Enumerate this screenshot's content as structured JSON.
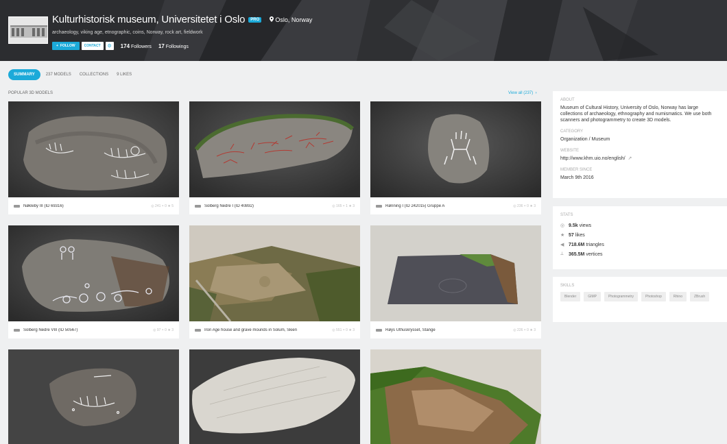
{
  "profile": {
    "name": "Kulturhistorisk museum, Universitetet i Oslo",
    "pro_badge": "PRO",
    "location": "Oslo, Norway",
    "tags": "archaeology, viking age, etnographic, coins, Norway, rock art, fieldwork",
    "follow_label": "FOLLOW",
    "contact_label": "CONTACT",
    "followers_count": "174",
    "followers_label": "Followers",
    "followings_count": "17",
    "followings_label": "Followings"
  },
  "tabs": [
    {
      "label": "SUMMARY",
      "active": true
    },
    {
      "label": "237 MODELS",
      "active": false
    },
    {
      "label": "COLLECTIONS",
      "active": false
    },
    {
      "label": "9 LIKES",
      "active": false
    }
  ],
  "popular": {
    "label": "POPULAR 3D MODELS",
    "view_all": "View all (237)",
    "models": [
      {
        "name": "Nøkleby III (ID 69316)",
        "meta": "◎ 241  ◓ 0  ★ 5"
      },
      {
        "name": "Solberg Nedre I (ID 40892)",
        "meta": "◎ 165  ◓ 1  ★ 3"
      },
      {
        "name": "Rønning I (ID 242015) Gruppe A",
        "meta": "◎ 236  ◓ 0  ★ 3"
      },
      {
        "name": "Solberg Nedre VIII (ID 50567)",
        "meta": "◎ 97  ◓ 0  ★ 3"
      },
      {
        "name": "Iron Age house and grave mounds in Solum, Skien",
        "meta": "◎ 551  ◓ 0  ★ 3"
      },
      {
        "name": "Røys Uthuskrysset, Stange",
        "meta": "◎ 226  ◓ 0  ★ 3"
      },
      {
        "name": "",
        "meta": ""
      },
      {
        "name": "",
        "meta": ""
      },
      {
        "name": "",
        "meta": ""
      }
    ]
  },
  "about": {
    "label": "ABOUT",
    "text": "Museum of Cultural History, University of Oslo, Norway has large collections of archaeology, ethnography and numismatics. We use both scanners and photogrammetry to create 3D models.",
    "category_label": "CATEGORY",
    "category": "Organization / Museum",
    "website_label": "WEBSITE",
    "website": "http://www.khm.uio.no/english/",
    "member_label": "MEMBER SINCE",
    "member_since": "March 9th 2016"
  },
  "stats": {
    "label": "STATS",
    "views": "9.5k",
    "views_label": "views",
    "likes": "57",
    "likes_label": "likes",
    "triangles": "718.6M",
    "triangles_label": "triangles",
    "vertices": "365.5M",
    "vertices_label": "vertices"
  },
  "skills": {
    "label": "SKILLS",
    "items": [
      "Blender",
      "GIMP",
      "Photogrammetry",
      "Photoshop",
      "Rhino",
      "ZBrush"
    ]
  }
}
